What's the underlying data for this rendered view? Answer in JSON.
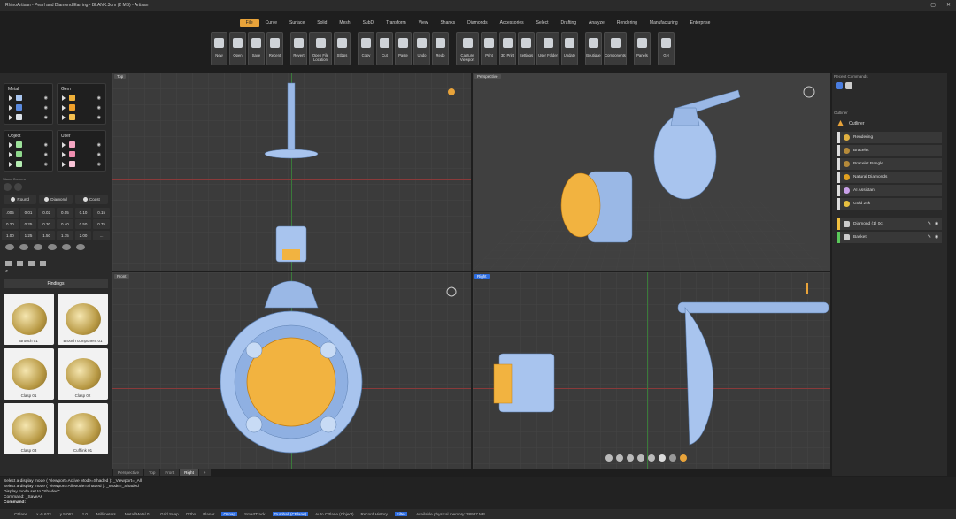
{
  "window": {
    "title": "RhinoArtisan - Pearl and Diamond Earring - BLANK.3dm (2 MB) - Artisan"
  },
  "menu": [
    "File",
    "Curve",
    "Surface",
    "Solid",
    "Mesh",
    "SubD",
    "Transform",
    "View",
    "Shanks",
    "Diamonds",
    "Accessories",
    "Select",
    "Drafting",
    "Analyze",
    "Rendering",
    "Manufacturing",
    "Enterprise"
  ],
  "toolbar": {
    "groups": [
      [
        "New",
        "Open",
        "Save",
        "Recent"
      ],
      [
        "Revert",
        "Open File Location",
        "Stl2ps"
      ],
      [
        "Copy",
        "Cut",
        "Paste",
        "Undo",
        "Redo"
      ],
      [
        "Capture Viewport",
        "Print",
        "3D Print",
        "Settings",
        "User Folder",
        "Update"
      ],
      [
        "Boutique",
        "Components"
      ],
      [
        "Panels"
      ],
      [
        "GH"
      ]
    ]
  },
  "layers": {
    "metal": "Metal",
    "gem": "Gem",
    "object": "Object",
    "user": "User",
    "metal_colors": [
      "#a9c6f0",
      "#5b8be0",
      "#dde3ea"
    ],
    "gem_colors": [
      "#f0b13a",
      "#f0a02a",
      "#f5c050"
    ],
    "object_colors": [
      "#9de29a",
      "#8fd98c",
      "#b6eeb3"
    ],
    "user_colors": [
      "#f4a6c2",
      "#f08fb0",
      "#f7c3d6"
    ]
  },
  "stones": {
    "label": "Stone Corners",
    "shapes": [
      "Round",
      "Diamond",
      "Coast"
    ],
    "sizes": [
      ".005",
      "0.01",
      "0.02",
      "0.05",
      "0.10",
      "0.15",
      "0.20",
      "0.25",
      "0.30",
      "0.40",
      "0.50",
      "0.75",
      "1.00",
      "1.25",
      "1.50",
      "1.75",
      "2.00",
      "..."
    ]
  },
  "findings": {
    "title": "Findings",
    "items": [
      "Brooch 01",
      "Brooch component 01",
      "Clasp 01",
      "Clasp 02",
      "Clasp 03",
      "Cufflink 01"
    ]
  },
  "viewports": {
    "top": "Top",
    "perspective": "Perspective",
    "front": "Front",
    "right": "Right"
  },
  "viewtabs": [
    "Perspective",
    "Top",
    "Front",
    "Right",
    "+"
  ],
  "right": {
    "recent": "Recent Commands",
    "outliner": "Outliner",
    "outline_title": "Outliner",
    "items": [
      "Rendering",
      "Bracelet",
      "Bracelet Bangle",
      "Natural Diamonds",
      "AI Assistant",
      "Gold 24k"
    ],
    "item_colors": [
      "#e0b040",
      "#b58a3a",
      "#b58a3a",
      "#e0a020",
      "#c8a0e8",
      "#e8c040"
    ],
    "objects": [
      "Diamond (1) 0ct",
      "Basket"
    ],
    "object_colors": [
      "#f0c040",
      "#5ac85a"
    ]
  },
  "command": {
    "lines": [
      "Select a display mode ( Viewport=Active  Mode=Shaded ): _Viewport=_All",
      "Select a display mode ( Viewport=All  Mode=Shaded ): _Mode=_Shaded",
      "Display mode set to \"Shaded\".",
      "Command: _SaveAs"
    ],
    "prompt": "Command:"
  },
  "status": {
    "plane": "CPlane",
    "x": "x -5.623",
    "y": "y 5.063",
    "z": "z 0",
    "units": "Millimeters",
    "layer": "Metal/Metal 01",
    "items": [
      "Grid Snap",
      "Ortho",
      "Planar",
      "Osnap",
      "SmartTrack",
      "Gumball (CPlane)",
      "Auto CPlane (Object)",
      "Record History",
      "Filter"
    ],
    "memory": "Available physical memory: 38937 MB"
  }
}
